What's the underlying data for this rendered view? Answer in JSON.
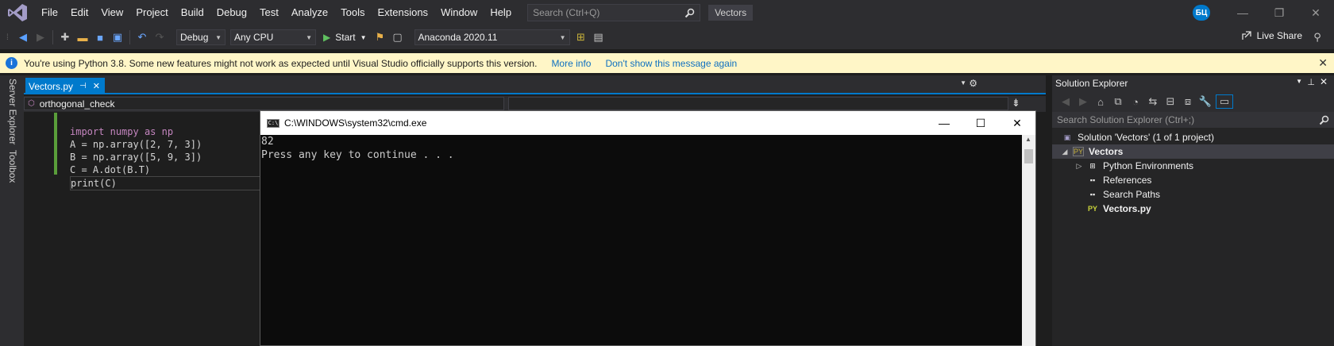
{
  "menubar": {
    "items": [
      "File",
      "Edit",
      "View",
      "Project",
      "Build",
      "Debug",
      "Test",
      "Analyze",
      "Tools",
      "Extensions",
      "Window",
      "Help"
    ],
    "search_placeholder": "Search (Ctrl+Q)",
    "solution_name": "Vectors",
    "user_initials": "БЦ"
  },
  "toolbar": {
    "config": "Debug",
    "platform": "Any CPU",
    "start_label": "Start",
    "environment": "Anaconda 2020.11",
    "live_share": "Live Share"
  },
  "infobar": {
    "message": "You're using Python 3.8. Some new features might not work as expected until Visual Studio officially supports this version.",
    "more_info": "More info",
    "dont_show": "Don't show this message again"
  },
  "side_tabs": [
    "Server Explorer",
    "Toolbox"
  ],
  "editor": {
    "tab_name": "Vectors.py",
    "nav_scope": "orthogonal_check",
    "lines": [
      "import numpy as np",
      "A = np.array([2, 7, 3])",
      "B = np.array([5, 9, 3])",
      "C = A.dot(B.T)",
      "print(C)"
    ]
  },
  "cmd": {
    "title": "C:\\WINDOWS\\system32\\cmd.exe",
    "output_line1": "82",
    "output_line2": "Press any key to continue . . ."
  },
  "solution_explorer": {
    "title": "Solution Explorer",
    "search_placeholder": "Search Solution Explorer (Ctrl+;)",
    "solution": "Solution 'Vectors' (1 of 1 project)",
    "project": "Vectors",
    "items": [
      "Python Environments",
      "References",
      "Search Paths",
      "Vectors.py"
    ]
  },
  "colors": {
    "accent": "#007acc",
    "infobar_bg": "#fff6c7",
    "link": "#0e70c0"
  }
}
